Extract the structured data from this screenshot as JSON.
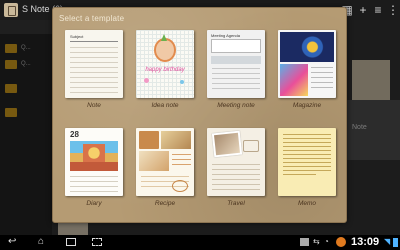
{
  "app": {
    "title": "S Note (6)"
  },
  "sidebar": {
    "items": [
      {
        "label": "Q..."
      },
      {
        "label": "Q..."
      },
      {
        "label": ""
      },
      {
        "label": ""
      }
    ]
  },
  "background": {
    "right_label": "Note"
  },
  "dialog": {
    "title": "Select a template",
    "templates": [
      {
        "label": "Note",
        "heading": "Subject"
      },
      {
        "label": "Idea note",
        "heading": "happy birthday"
      },
      {
        "label": "Meeting note",
        "heading": "Meeting Agenda"
      },
      {
        "label": "Magazine",
        "heading": ""
      },
      {
        "label": "Diary",
        "heading": "28"
      },
      {
        "label": "Recipe",
        "heading": ""
      },
      {
        "label": "Travel",
        "heading": ""
      },
      {
        "label": "Memo",
        "heading": ""
      }
    ]
  },
  "statusbar": {
    "time": "13:09"
  },
  "colors": {
    "dialog_bg": "#b59b73",
    "label_text": "#4b3520",
    "folder": "#d9a21e"
  },
  "icons": {
    "topbar": [
      "grid-icon",
      "plus-icon",
      "menu-icon",
      "more-icon"
    ],
    "nav": [
      "back-icon",
      "home-icon",
      "recent-apps-icon",
      "screenshot-icon"
    ],
    "status": [
      "picture-icon",
      "usb-icon",
      "alarm-icon",
      "battery-icon",
      "wifi-icon"
    ]
  }
}
